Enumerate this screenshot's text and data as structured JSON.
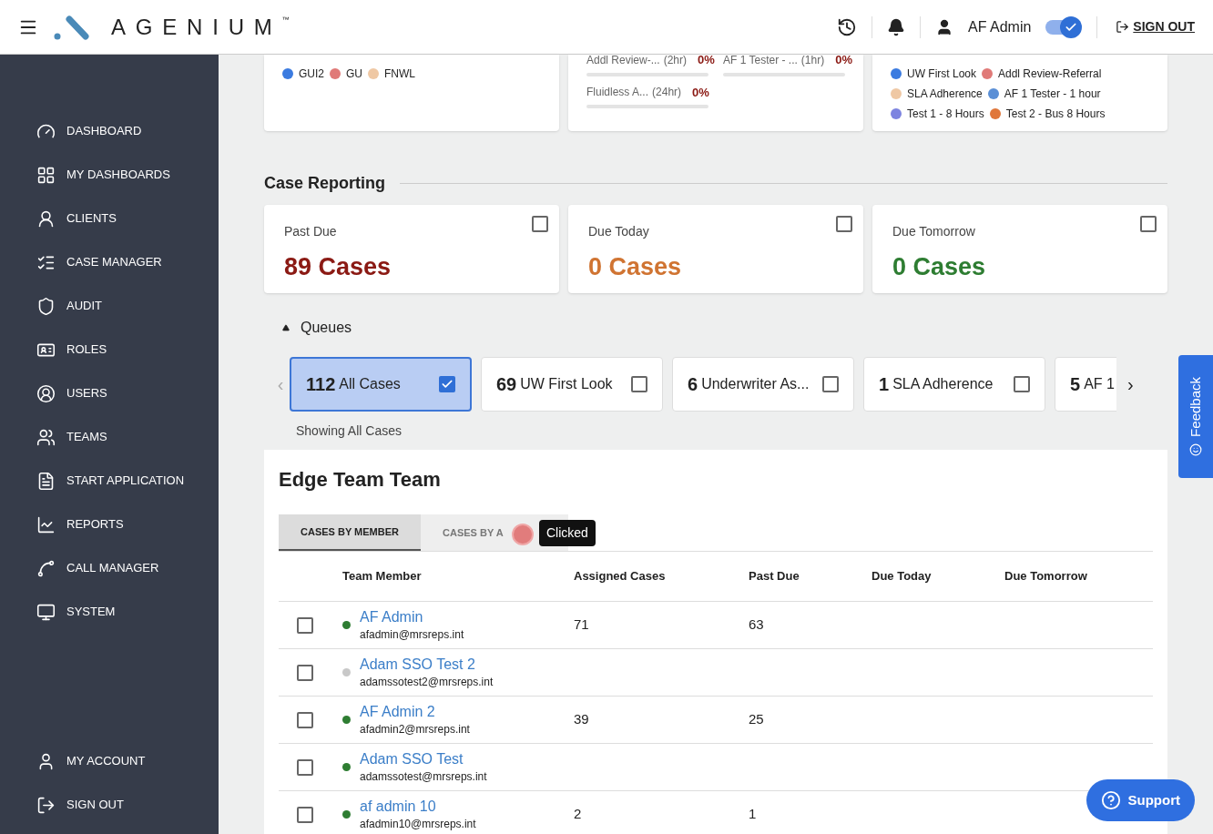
{
  "header": {
    "logo": "AGENIUM",
    "trademark": "™",
    "user": "AF Admin",
    "toggle_on": true,
    "sign_out": "SIGN OUT"
  },
  "sidebar": {
    "items": [
      {
        "label": "DASHBOARD"
      },
      {
        "label": "MY DASHBOARDS"
      },
      {
        "label": "CLIENTS"
      },
      {
        "label": "CASE MANAGER"
      },
      {
        "label": "AUDIT"
      },
      {
        "label": "ROLES"
      },
      {
        "label": "USERS"
      },
      {
        "label": "TEAMS"
      },
      {
        "label": "START APPLICATION"
      },
      {
        "label": "REPORTS"
      },
      {
        "label": "CALL MANAGER"
      },
      {
        "label": "SYSTEM"
      }
    ],
    "bottom_items": [
      {
        "label": "MY ACCOUNT"
      },
      {
        "label": "SIGN OUT"
      }
    ]
  },
  "top_cards": {
    "legend_left": [
      {
        "label": "GUI2",
        "color": "#3b7be0"
      },
      {
        "label": "GU",
        "color": "#e07a78"
      },
      {
        "label": "FNWL",
        "color": "#efc8a4"
      }
    ],
    "progress": [
      {
        "label": "Addl Review-...",
        "duration": "(2hr)",
        "percent": "0%",
        "level": 0
      },
      {
        "label": "AF 1 Tester - ...",
        "duration": "(1hr)",
        "percent": "0%",
        "level": 0
      },
      {
        "label": "Fluidless A...",
        "duration": "(24hr)",
        "percent": "0%",
        "level": 0
      }
    ],
    "legend_right": [
      {
        "label": "UW First Look",
        "color": "#3b7be0"
      },
      {
        "label": "Addl Review-Referral",
        "color": "#e07a78"
      },
      {
        "label": "SLA Adherence",
        "color": "#efc8a4"
      },
      {
        "label": "AF 1 Tester - 1 hour",
        "color": "#5b8fd6"
      },
      {
        "label": "Test 1 - 8 Hours",
        "color": "#7d84e0"
      },
      {
        "label": "Test 2 - Bus 8 Hours",
        "color": "#e0773a"
      }
    ]
  },
  "case_reporting": {
    "title": "Case Reporting",
    "cards": [
      {
        "label": "Past Due",
        "value": "89 Cases",
        "color": "#8b1a14",
        "checked": false
      },
      {
        "label": "Due Today",
        "value": "0 Cases",
        "color": "#d07432",
        "checked": false
      },
      {
        "label": "Due Tomorrow",
        "value": "0 Cases",
        "color": "#2e7d32",
        "checked": false
      }
    ]
  },
  "queues": {
    "title": "Queues",
    "expanded": true,
    "prev": "‹",
    "next": "›",
    "items": [
      {
        "count": "112",
        "label": "All Cases",
        "selected": true
      },
      {
        "count": "69",
        "label": "UW First Look",
        "selected": false
      },
      {
        "count": "6",
        "label": "Underwriter As...",
        "selected": false
      },
      {
        "count": "1",
        "label": "SLA Adherence",
        "selected": false
      },
      {
        "count": "5",
        "label": "AF 1",
        "selected": false
      }
    ],
    "caption": "Showing All Cases"
  },
  "team": {
    "title": "Edge Team Team",
    "tabs": [
      {
        "label": "CASES BY MEMBER",
        "selected": true
      },
      {
        "label": "CASES BY A",
        "selected": false
      }
    ],
    "tooltip": "Clicked",
    "columns": [
      "Team Member",
      "Assigned Cases",
      "Past Due",
      "Due Today",
      "Due Tomorrow"
    ],
    "rows": [
      {
        "name": "AF Admin",
        "email": "afadmin@mrsreps.int",
        "online": true,
        "assigned": "71",
        "past_due": "63",
        "checked": false
      },
      {
        "name": "Adam SSO Test 2",
        "email": "adamssotest2@mrsreps.int",
        "online": false,
        "checked": false
      },
      {
        "name": "AF Admin 2",
        "email": "afadmin2@mrsreps.int",
        "online": true,
        "assigned": "39",
        "past_due": "25",
        "checked": false
      },
      {
        "name": "Adam SSO Test",
        "email": "adamssotest@mrsreps.int",
        "online": true,
        "checked": false
      },
      {
        "name": "af admin 10",
        "email": "afadmin10@mrsreps.int",
        "online": true,
        "assigned": "2",
        "past_due": "1",
        "checked": false
      }
    ]
  },
  "feedback": "Feedback",
  "support": "Support"
}
